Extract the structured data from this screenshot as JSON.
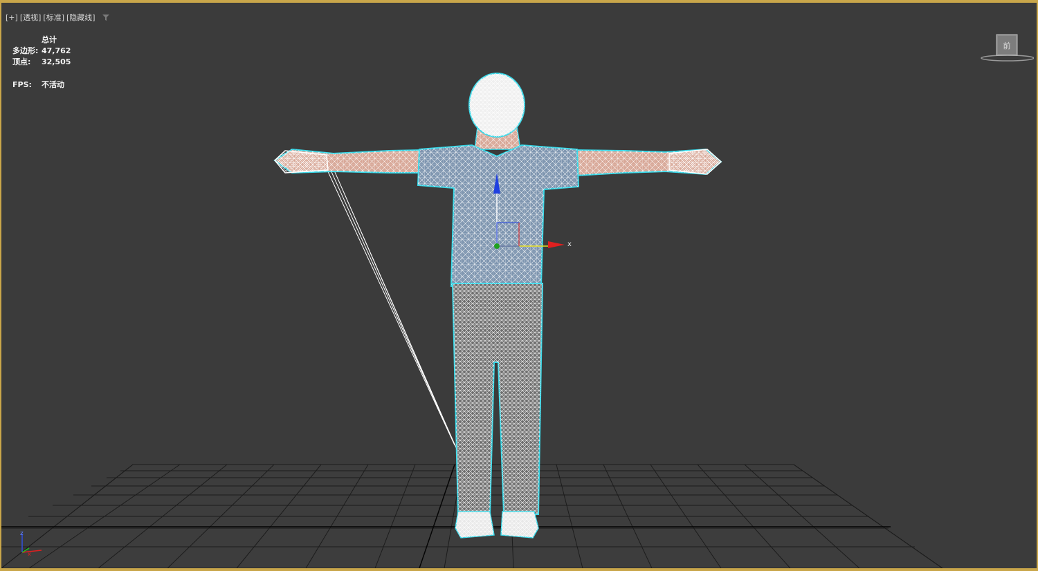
{
  "viewport": {
    "labels": [
      "[+]",
      "[透视]",
      "[标准]",
      "[隐藏线]"
    ]
  },
  "stats": {
    "header": "总计",
    "polygons_label": "多边形:",
    "polygons_value": "47,762",
    "vertices_label": "顶点:",
    "vertices_value": "32,505",
    "fps_label": "FPS:",
    "fps_value": "不活动"
  },
  "gizmo": {
    "x_label": "x"
  },
  "viewcube": {
    "face_label": "前"
  },
  "colors": {
    "background": "#3b3b3b",
    "active_border": "#c9a64a",
    "wire": "#ffffff",
    "selection_outline": "#37d8e8",
    "axis_x": "#e02020",
    "axis_y": "#20c020",
    "axis_z": "#2040e0",
    "grid": "#1a1a1a"
  },
  "icons": {
    "filter": "filter-icon",
    "world_axis": "world-axis-icon"
  }
}
